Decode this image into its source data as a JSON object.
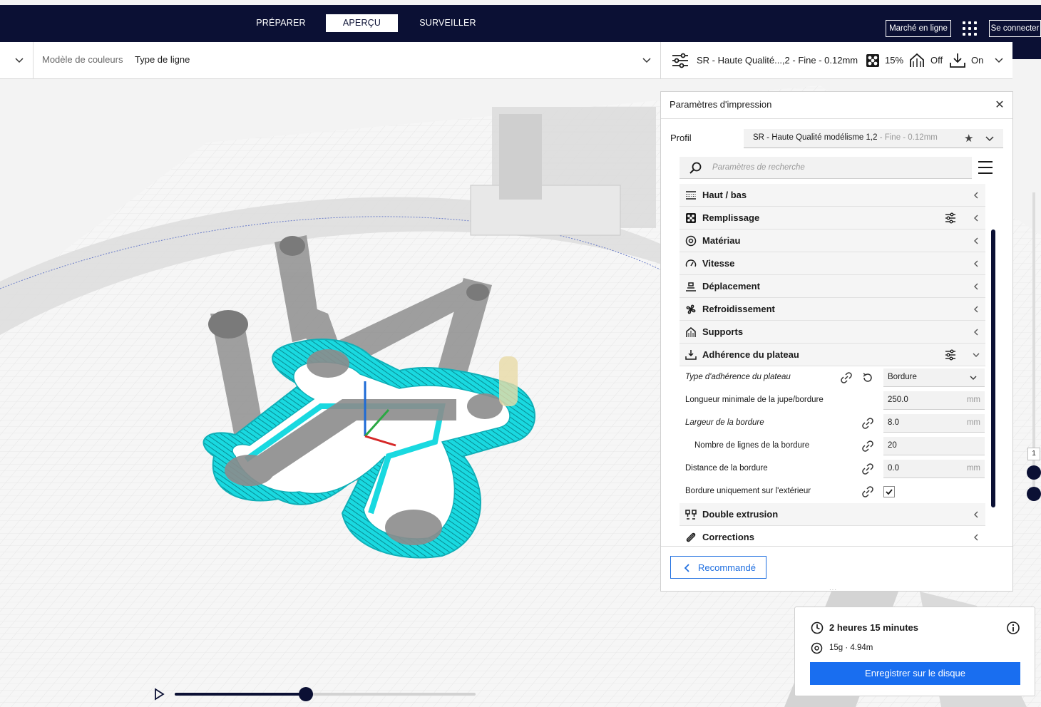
{
  "header": {
    "tabs": [
      {
        "label": "PRÉPARER",
        "active": false
      },
      {
        "label": "APERÇU",
        "active": true
      },
      {
        "label": "SURVEILLER",
        "active": false
      }
    ],
    "marketplace_label": "Marché en ligne",
    "signin_label": "Se connecter"
  },
  "color_bar": {
    "scheme_label": "Modèle de couleurs",
    "scheme_value": "Type de ligne"
  },
  "settings_bar": {
    "profile_summary": "SR - Haute Qualité...,2 - Fine - 0.12mm",
    "infill": "15%",
    "support": "Off",
    "adhesion": "On"
  },
  "panel": {
    "title": "Paramètres d'impression",
    "profile_label": "Profil",
    "profile_name": "SR - Haute Qualité modélisme 1,2",
    "profile_suffix": " - Fine - 0.12mm",
    "search_placeholder": "Paramètres de recherche",
    "categories": [
      {
        "label": "Haut / bas",
        "icon": "top-bottom-icon"
      },
      {
        "label": "Remplissage",
        "icon": "infill-icon"
      },
      {
        "label": "Matériau",
        "icon": "material-icon"
      },
      {
        "label": "Vitesse",
        "icon": "speed-icon"
      },
      {
        "label": "Déplacement",
        "icon": "travel-icon"
      },
      {
        "label": "Refroidissement",
        "icon": "cooling-icon"
      },
      {
        "label": "Supports",
        "icon": "support-icon"
      },
      {
        "label": "Adhérence du plateau",
        "icon": "adhesion-icon"
      },
      {
        "label": "Double extrusion",
        "icon": "dual-extrusion-icon"
      },
      {
        "label": "Corrections",
        "icon": "corrections-icon"
      }
    ],
    "settings": [
      {
        "label": "Type d'adhérence du plateau",
        "value": "Bordure",
        "unit": ""
      },
      {
        "label": "Longueur minimale de la jupe/bordure",
        "value": "250.0",
        "unit": "mm"
      },
      {
        "label": "Largeur de la bordure",
        "value": "8.0",
        "unit": "mm"
      },
      {
        "label": "Nombre de lignes de la bordure",
        "value": "20",
        "unit": ""
      },
      {
        "label": "Distance de la bordure",
        "value": "0.0",
        "unit": "mm"
      },
      {
        "label": "Bordure uniquement sur l'extérieur",
        "checked": true
      }
    ],
    "recommended_label": "Recommandé"
  },
  "print_info": {
    "time": "2 heures 15 minutes",
    "material": "15g · 4.94m",
    "save_label": "Enregistrer sur le disque"
  },
  "layer_slider": {
    "current": "1"
  },
  "playback": {
    "progress": 0.44
  },
  "colors": {
    "navy": "#0b1034",
    "accent_blue": "#196ef0",
    "brim_cyan": "#18d6dc",
    "model_gray": "#8c8c8c"
  }
}
